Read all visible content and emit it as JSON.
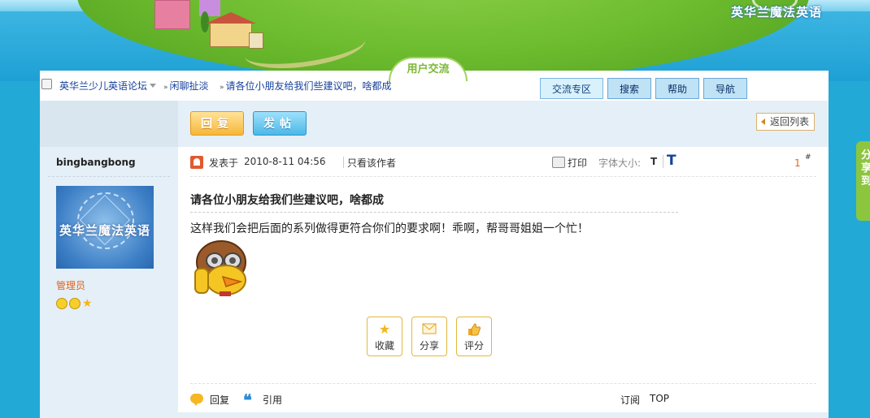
{
  "header": {
    "brand": "英华兰魔法英语",
    "section_tab": "用户交流"
  },
  "breadcrumb": {
    "items": [
      {
        "label": "英华兰少儿英语论坛",
        "has_caret": true
      },
      {
        "label": "闲聊扯淡"
      },
      {
        "label": "请各位小朋友给我们些建议吧，啥都成"
      }
    ],
    "separator": "»"
  },
  "nav": {
    "items": [
      {
        "label": "交流专区",
        "active": true
      },
      {
        "label": "搜索"
      },
      {
        "label": "帮助"
      },
      {
        "label": "导航"
      }
    ]
  },
  "actions": {
    "reply": "回复",
    "post": "发帖",
    "back_to_list": "返回列表"
  },
  "author": {
    "name": "bingbangbong",
    "avatar_text": "英华兰魔法英语",
    "role": "管理员"
  },
  "post": {
    "posted_label": "发表于",
    "posted_time": "2010-8-11 04:56",
    "only_author": "只看该作者",
    "print": "打印",
    "font_size_label": "字体大小:",
    "font_small": "T",
    "font_large": "T",
    "floor": "1",
    "floor_suffix": "#",
    "title": "请各位小朋友给我们些建议吧，啥都成",
    "body": "这样我们会把后面的系列做得更符合你们的要求啊！乖啊，帮哥哥姐姐一个忙！"
  },
  "post_actions": [
    {
      "label": "收藏",
      "icon": "star-icon"
    },
    {
      "label": "分享",
      "icon": "share-icon"
    },
    {
      "label": "评分",
      "icon": "thumb-icon"
    }
  ],
  "bottom": {
    "reply": "回复",
    "quote": "引用",
    "subscribe": "订阅",
    "top": "TOP"
  },
  "side_tab": "分享到",
  "colors": {
    "page_bg": "#22a9d6",
    "link": "#16419d",
    "role": "#e0641a",
    "reply_btn": "#f7b738",
    "post_btn": "#4cb8e8"
  }
}
